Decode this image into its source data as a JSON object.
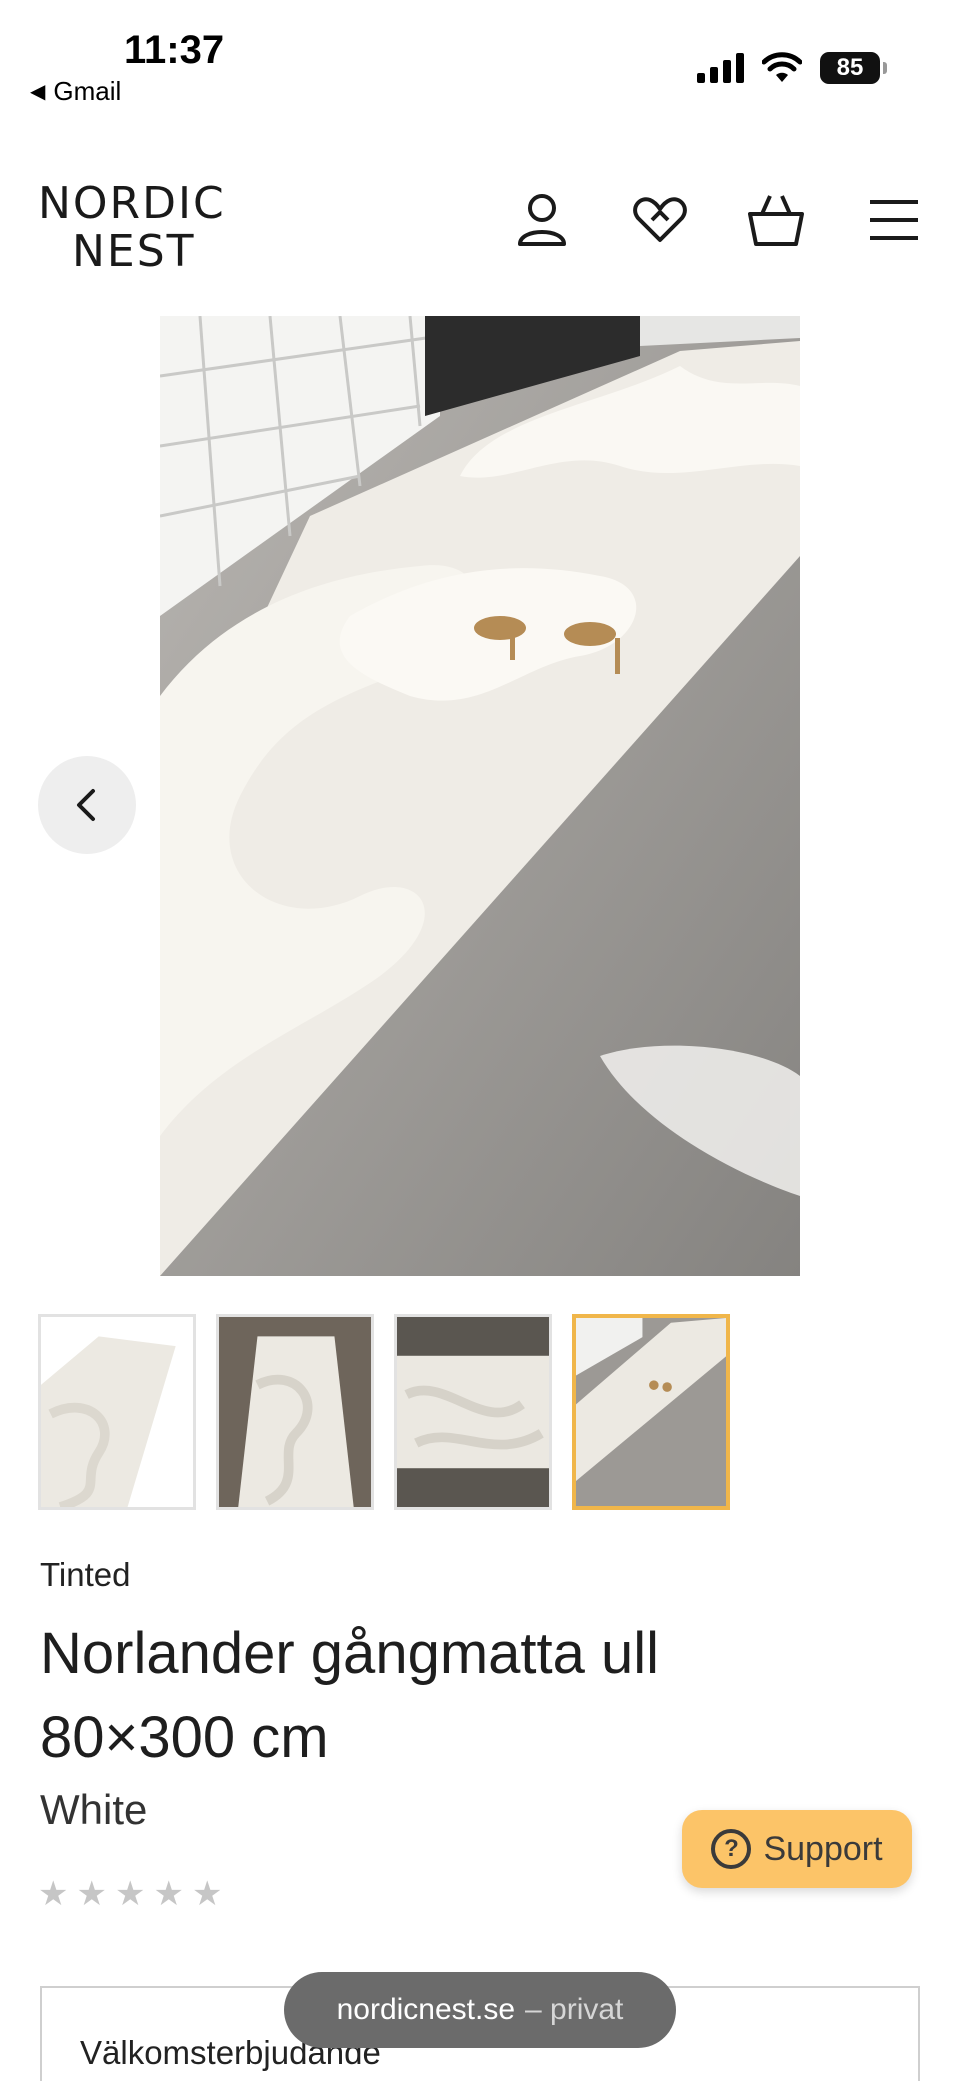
{
  "status_bar": {
    "time": "11:37",
    "back_app": "Gmail",
    "battery": "85"
  },
  "header": {
    "logo_line1": "NORDIC",
    "logo_line2": "NEST",
    "icons": [
      "user-icon",
      "heart-icon",
      "basket-icon",
      "menu-icon"
    ]
  },
  "gallery": {
    "thumbnail_count": 4,
    "active_thumbnail": 4,
    "highlight_color": "#f0b64a"
  },
  "product": {
    "brand": "Tinted",
    "title": "Norlander gångmatta ull 80×300 cm",
    "color": "White",
    "rating_stars": 5
  },
  "support": {
    "label": "Support",
    "color": "#fcc468"
  },
  "offer": {
    "label": "Välkomsterbjudande"
  },
  "browser": {
    "domain": "nordicnest.se",
    "mode": "– privat"
  }
}
